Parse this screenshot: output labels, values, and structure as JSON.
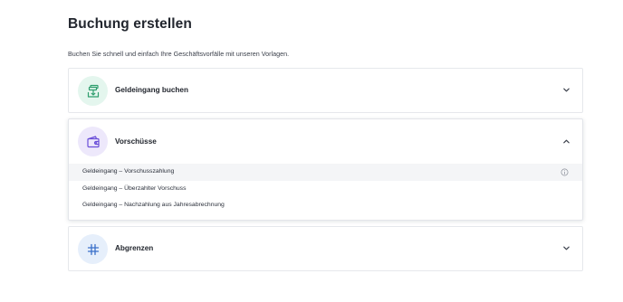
{
  "page": {
    "title": "Buchung erstellen",
    "subtitle": "Buchen Sie schnell und einfach Ihre Geschäftsvorfälle mit unseren Vorlagen."
  },
  "cards": [
    {
      "title": "Geldeingang buchen",
      "icon": "money-inbox-icon",
      "icon_bg": "#e4f6ee",
      "icon_color": "#2f9e6e",
      "expanded": false
    },
    {
      "title": "Vorschüsse",
      "icon": "wallet-icon",
      "icon_bg": "#ede8fb",
      "icon_color": "#6b4fd8",
      "expanded": true,
      "items": [
        {
          "label": "Geldeingang – Vorschusszahlung",
          "highlighted": true,
          "info_icon": "info-icon"
        },
        {
          "label": "Geldeingang – Überzahlter Vorschuss",
          "highlighted": false
        },
        {
          "label": "Geldeingang – Nachzahlung aus Jahresabrechnung",
          "highlighted": false
        }
      ]
    },
    {
      "title": "Abgrenzen",
      "icon": "hash-icon",
      "icon_bg": "#e6effb",
      "icon_color": "#3a6fc9",
      "expanded": false
    }
  ]
}
